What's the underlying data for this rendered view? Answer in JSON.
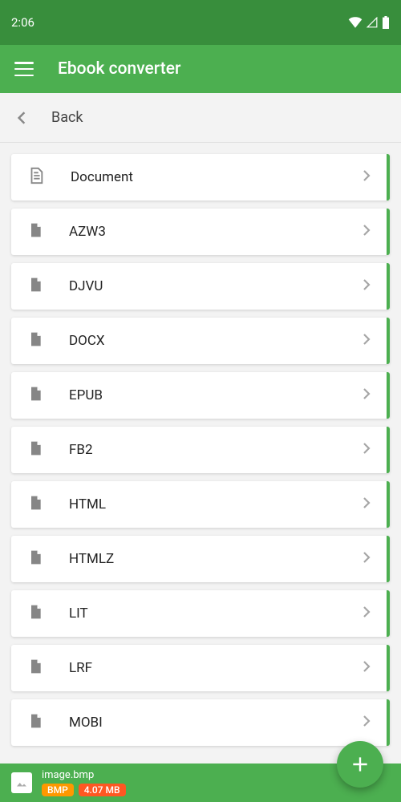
{
  "status": {
    "time": "2:06"
  },
  "app_bar": {
    "title": "Ebook converter"
  },
  "breadcrumb": {
    "label": "Back"
  },
  "formats": [
    {
      "label": "Document",
      "icon": "document"
    },
    {
      "label": "AZW3",
      "icon": "file"
    },
    {
      "label": "DJVU",
      "icon": "file"
    },
    {
      "label": "DOCX",
      "icon": "file"
    },
    {
      "label": "EPUB",
      "icon": "file"
    },
    {
      "label": "FB2",
      "icon": "file"
    },
    {
      "label": "HTML",
      "icon": "file"
    },
    {
      "label": "HTMLZ",
      "icon": "file"
    },
    {
      "label": "LIT",
      "icon": "file"
    },
    {
      "label": "LRF",
      "icon": "file"
    },
    {
      "label": "MOBI",
      "icon": "file"
    }
  ],
  "bottom": {
    "filename": "image.bmp",
    "ext_badge": "BMP",
    "size_badge": "4.07 MB"
  }
}
